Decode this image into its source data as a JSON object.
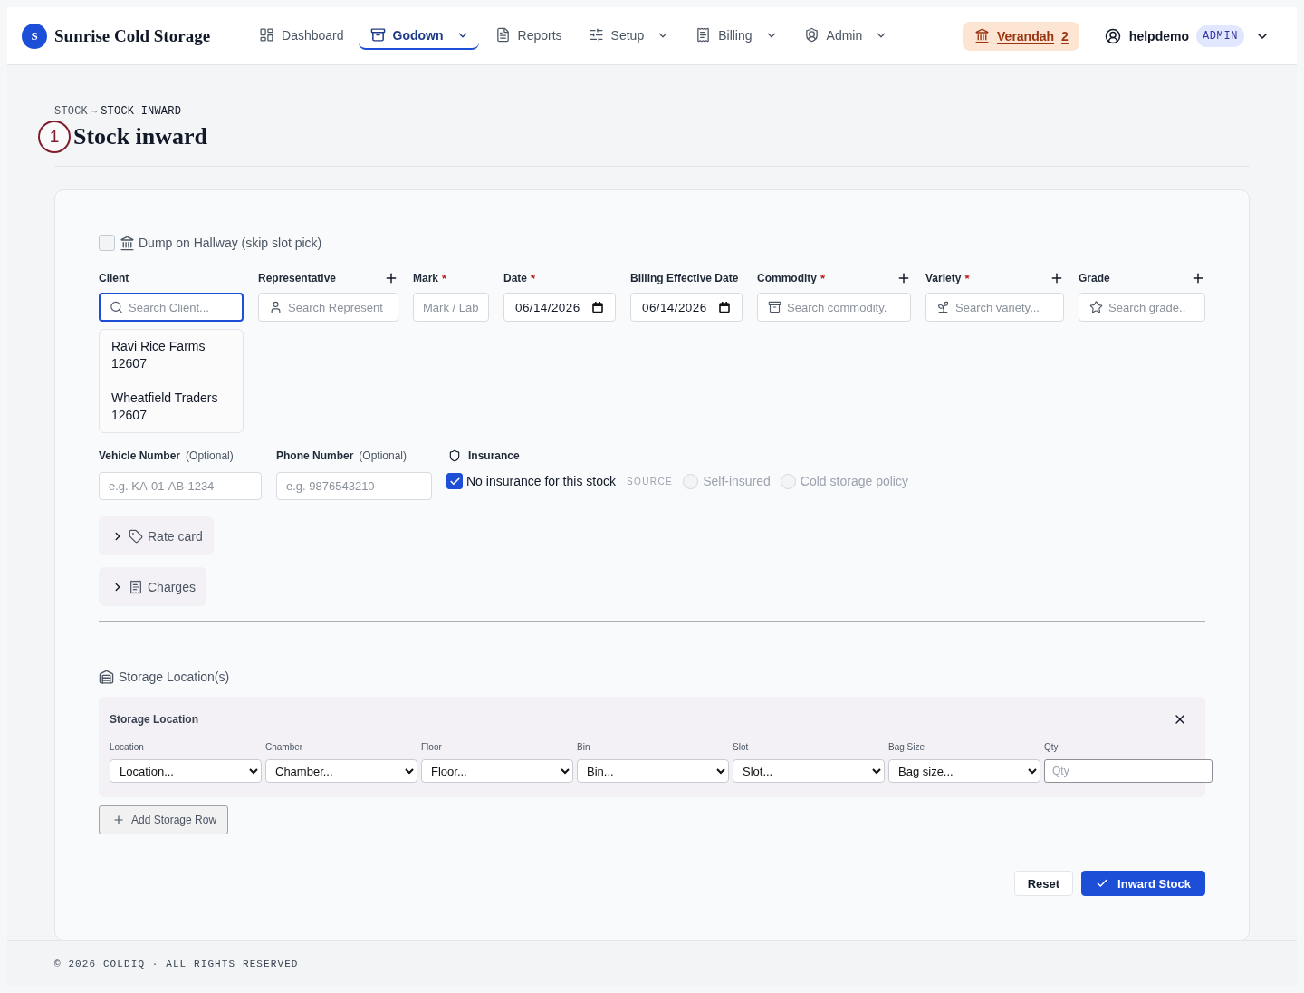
{
  "header": {
    "logo_letter": "S",
    "brand": "Sunrise Cold Storage",
    "nav": [
      {
        "label": "Dashboard",
        "selected": false,
        "has_menu": false
      },
      {
        "label": "Godown",
        "selected": true,
        "has_menu": true
      },
      {
        "label": "Reports",
        "selected": false,
        "has_menu": false
      },
      {
        "label": "Setup",
        "selected": false,
        "has_menu": true
      },
      {
        "label": "Billing",
        "selected": false,
        "has_menu": true
      },
      {
        "label": "Admin",
        "selected": false,
        "has_menu": true
      }
    ],
    "location_chip": {
      "label": "Verandah",
      "count": "2"
    },
    "user": {
      "name": "helpdemo",
      "role": "ADMIN"
    }
  },
  "breadcrumb": {
    "items": [
      "STOCK",
      "STOCK INWARD"
    ],
    "separator": "→"
  },
  "callout": "1",
  "title": "Stock inward",
  "form": {
    "hallway": {
      "label": "Dump on Hallway (skip slot pick)",
      "checked": false
    },
    "required_mark": "*",
    "fields": [
      {
        "kind": "search",
        "label": "Client",
        "required": false,
        "addable": false,
        "focused": true,
        "placeholder": "Search Client...",
        "suggestions": [
          {
            "name": "Ravi Rice Farms",
            "code": "12607"
          },
          {
            "name": "Wheatfield Traders",
            "code": "12607"
          }
        ]
      },
      {
        "kind": "search",
        "label": "Representative",
        "required": false,
        "addable": true,
        "focused": false,
        "placeholder": "Search Represent"
      },
      {
        "kind": "text",
        "label": "Mark",
        "required": true,
        "addable": false,
        "focused": false,
        "placeholder": "Mark / Lab"
      },
      {
        "kind": "date",
        "label": "Date",
        "required": true,
        "addable": false,
        "focused": false,
        "value": "06/14/2026"
      },
      {
        "kind": "date",
        "label": "Billing Effective Date",
        "required": false,
        "addable": false,
        "focused": false,
        "value": "06/14/2026"
      },
      {
        "kind": "search",
        "label": "Commodity",
        "required": true,
        "addable": true,
        "focused": false,
        "placeholder": "Search commodity."
      },
      {
        "kind": "search",
        "label": "Variety",
        "required": true,
        "addable": true,
        "focused": false,
        "placeholder": "Search variety..."
      },
      {
        "kind": "search",
        "label": "Grade",
        "required": false,
        "addable": true,
        "focused": false,
        "placeholder": "Search grade.."
      }
    ],
    "contact_fields": [
      {
        "label": "Vehicle Number",
        "hint": "(Optional)",
        "placeholder": "e.g. KA-01-AB-1234"
      },
      {
        "label": "Phone Number",
        "hint": "(Optional)",
        "placeholder": "e.g. 9876543210"
      }
    ],
    "insurance": {
      "label": "Insurance",
      "none_option": {
        "label": "No insurance for this stock",
        "checked": true
      },
      "source_label": "SOURCE",
      "sources": [
        {
          "label": "Self-insured",
          "selected": false,
          "disabled": true
        },
        {
          "label": "Cold storage policy",
          "selected": false,
          "disabled": true
        }
      ]
    },
    "sections": [
      {
        "label": "Rate card",
        "expanded": false
      },
      {
        "label": "Charges",
        "expanded": false
      }
    ]
  },
  "storage": {
    "heading": "Storage Location(s)",
    "panel_title": "Storage Location",
    "columns": [
      {
        "kind": "select",
        "label": "Location",
        "value": "Location..."
      },
      {
        "kind": "select",
        "label": "Chamber",
        "value": "Chamber..."
      },
      {
        "kind": "select",
        "label": "Floor",
        "value": "Floor..."
      },
      {
        "kind": "select",
        "label": "Bin",
        "value": "Bin..."
      },
      {
        "kind": "select",
        "label": "Slot",
        "value": "Slot..."
      },
      {
        "kind": "select",
        "label": "Bag Size",
        "value": "Bag size..."
      },
      {
        "kind": "input",
        "label": "Qty",
        "placeholder": "Qty"
      }
    ],
    "add_button": "Add Storage Row"
  },
  "actions": [
    {
      "kind": "secondary",
      "label": "Reset"
    },
    {
      "kind": "primary",
      "label": "Inward Stock"
    }
  ],
  "footer": "© 2026 COLDIQ · ALL RIGHTS RESERVED"
}
